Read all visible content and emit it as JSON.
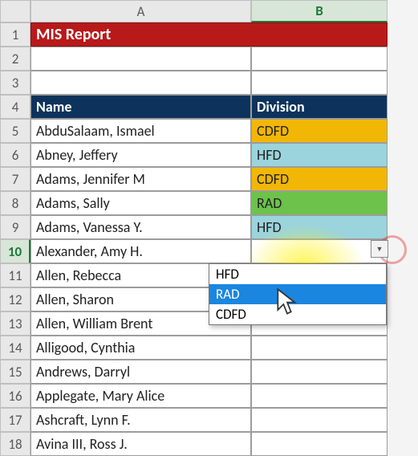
{
  "columns": [
    "A",
    "B"
  ],
  "selectedColumn": "B",
  "selectedRow": 10,
  "titleRow": 1,
  "title": "MIS Report",
  "headerRow": 4,
  "headers": {
    "name": "Name",
    "division": "Division"
  },
  "rows": [
    {
      "n": 1
    },
    {
      "n": 2
    },
    {
      "n": 3
    },
    {
      "n": 4
    },
    {
      "n": 5,
      "name": "AbduSalaam, Ismael",
      "division": "CDFD"
    },
    {
      "n": 6,
      "name": "Abney, Jeffery",
      "division": "HFD"
    },
    {
      "n": 7,
      "name": "Adams, Jennifer M",
      "division": "CDFD"
    },
    {
      "n": 8,
      "name": "Adams, Sally",
      "division": "RAD"
    },
    {
      "n": 9,
      "name": "Adams, Vanessa Y.",
      "division": "HFD"
    },
    {
      "n": 10,
      "name": "Alexander, Amy H.",
      "division": ""
    },
    {
      "n": 11,
      "name": "Allen, Rebecca",
      "division": ""
    },
    {
      "n": 12,
      "name": "Allen, Sharon",
      "division": ""
    },
    {
      "n": 13,
      "name": "Allen, William Brent",
      "division": ""
    },
    {
      "n": 14,
      "name": "Alligood, Cynthia",
      "division": ""
    },
    {
      "n": 15,
      "name": "Andrews, Darryl",
      "division": ""
    },
    {
      "n": 16,
      "name": "Applegate, Mary Alice",
      "division": ""
    },
    {
      "n": 17,
      "name": "Ashcraft, Lynn F.",
      "division": ""
    },
    {
      "n": 18,
      "name": "Avina III, Ross J.",
      "division": ""
    }
  ],
  "divisionColors": {
    "CDFD": "#f2b705",
    "HFD": "#9bd4dc",
    "RAD": "#6cc24a"
  },
  "dropdown": {
    "options": [
      "HFD",
      "RAD",
      "CDFD"
    ],
    "selected": "RAD"
  }
}
